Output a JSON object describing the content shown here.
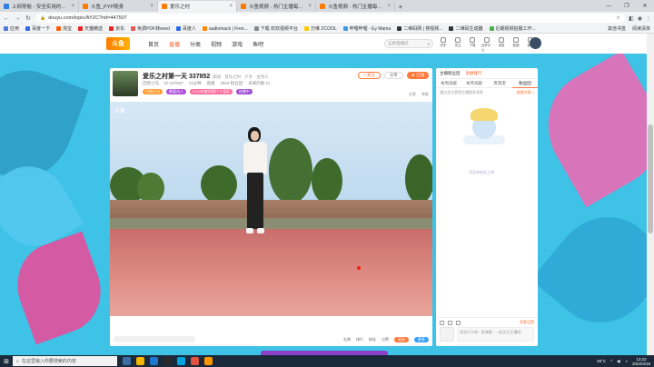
{
  "browser": {
    "tabs": [
      {
        "title": "上网导航 - 安全实用的网址导航",
        "close": "×",
        "color": "#2f7fe6",
        "active": false
      },
      {
        "title": "斗鱼_PYP随身",
        "close": "×",
        "color": "#ff7a00",
        "active": false
      },
      {
        "title": "爱乐之村",
        "close": "×",
        "color": "#ff7a00",
        "active": true
      },
      {
        "title": "斗鱼视频 - 热门主播每天独家视频",
        "close": "×",
        "color": "#ff7a00",
        "active": false
      },
      {
        "title": "斗鱼视频 - 热门主播每天独家视频",
        "close": "×",
        "color": "#ff7a00",
        "active": false
      }
    ],
    "new_tab": "+",
    "window_controls": [
      "—",
      "❐",
      "✕"
    ],
    "nav": {
      "back": "←",
      "forward": "→",
      "reload": "↻",
      "home": "⌂"
    },
    "url": "douyu.com/topic/AYZC?rid=447507",
    "lock": "🔒",
    "bookmarks": [
      {
        "label": "应用",
        "color": "#4a7bd8"
      },
      {
        "label": "百度一下",
        "color": "#2b6de6"
      },
      {
        "label": "淘宝",
        "color": "#ff5a00"
      },
      {
        "label": "天猫精选",
        "color": "#e22"
      },
      {
        "label": "京东",
        "color": "#e22"
      },
      {
        "label": "免费PDF转word",
        "color": "#e55"
      },
      {
        "label": "百度人",
        "color": "#2b6de6"
      },
      {
        "label": "audiomack | Free...",
        "color": "#f80"
      },
      {
        "label": "下载 欢欢视频平台",
        "color": "#888"
      },
      {
        "label": "万维 ZCOOL",
        "color": "#fc0"
      },
      {
        "label": "哔哩哔哩 - Ey Mama",
        "color": "#3a9be8"
      },
      {
        "label": "二维码网 | 搜视频...",
        "color": "#333"
      },
      {
        "label": "二维码生成器",
        "color": "#333"
      },
      {
        "label": "近期视频拍摄工作...",
        "color": "#4caf50"
      }
    ],
    "bookmarks_right": [
      "其他书签",
      "阅读清单"
    ]
  },
  "site": {
    "logo": "斗鱼",
    "nav": [
      "首页",
      "直播",
      "分类",
      "视频",
      "游戏",
      "鱼吧"
    ],
    "nav_active": "直播",
    "search_placeholder": "五桥直播间",
    "search_icon": "⌕",
    "header_icons": [
      "历史",
      "关注",
      "下载",
      "创作中心",
      "消息",
      "鱼翅",
      "鱼丸"
    ]
  },
  "player": {
    "title": "爱乐之村第一天 337852",
    "category": "颜值 · 音乐之村 · 户外 · 主持人",
    "meta": [
      "巴哈小马",
      "ID 447507",
      "11分钟",
      "直播",
      "2915 粉丝团",
      "未来的歌 21"
    ],
    "badges": [
      {
        "label": "巴哈小马",
        "color": "#ff9a2e"
      },
      {
        "label": "颜值达人",
        "color": "#ad4fd9"
      },
      {
        "label": "2019年度风景打卡领奖",
        "color": "#ff6b9a"
      },
      {
        "label": "热播中",
        "color": "#9c4bd0"
      }
    ],
    "actions": {
      "follow": "+ 关注",
      "share": "分享",
      "subscribe": "★ 订阅"
    },
    "small": [
      "分享",
      "举报"
    ],
    "watermark": "斗鱼",
    "controls": {
      "gift": "礼物",
      "rank": "排行",
      "fans": "粉丝",
      "like": "点赞",
      "send": "发送",
      "more": "更多"
    }
  },
  "chat": {
    "top": [
      "主播粉丝团",
      "贡献排行",
      "弹幕"
    ],
    "tabs": [
      "本周贡献",
      "本月贡献",
      "贵宾席",
      "粉丝团"
    ],
    "active_tab": "粉丝团",
    "notice": "通过关注获得主播更多消息",
    "notice_link": "查看详情 >",
    "mascot_caption": "还没有粉丝上榜",
    "tools_right": "背景设置",
    "input_placeholder": "说些什么吧~  发弹幕，一起关注主播吧"
  },
  "taskbar": {
    "start": "⊞",
    "search_placeholder": "在这里输入你要搜索的内容",
    "apps": [
      "#3a6ea5",
      "#f5b400",
      "#1f77d0",
      "#2a2a2a",
      "#00a3e0",
      "#e2543f",
      "#ff9500"
    ],
    "weather": "26°C",
    "time": "13:22",
    "date": "2022/3/16"
  },
  "colors": {
    "page_bg": "#3ec3e6",
    "accent": "#ff5d23",
    "purple_pill": "#8b3fc9"
  }
}
